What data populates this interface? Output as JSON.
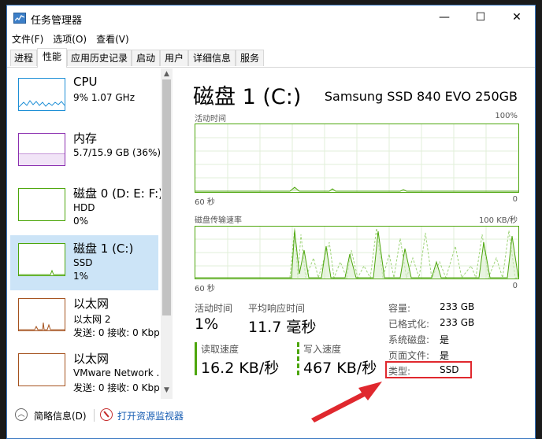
{
  "window": {
    "title": "任务管理器",
    "minimize": "—",
    "maximize": "☐",
    "close": "✕"
  },
  "menu": [
    "文件(F)",
    "选项(O)",
    "查看(V)"
  ],
  "tabs": [
    "进程",
    "性能",
    "应用历史记录",
    "启动",
    "用户",
    "详细信息",
    "服务"
  ],
  "active_tab": "性能",
  "sidebar": [
    {
      "name": "CPU",
      "sub1": "9% 1.07 GHz",
      "sub2": "",
      "color": "#1e8fd6"
    },
    {
      "name": "内存",
      "sub1": "5.7/15.9 GB (36%)",
      "sub2": "",
      "color": "#8b2fb0"
    },
    {
      "name": "磁盘 0 (D: E: F:)",
      "sub1": "HDD",
      "sub2": "0%",
      "color": "#4da60c"
    },
    {
      "name": "磁盘 1 (C:)",
      "sub1": "SSD",
      "sub2": "1%",
      "color": "#4da60c"
    },
    {
      "name": "以太网",
      "sub1": "以太网 2",
      "sub2": "发送: 0 接收: 0 Kbp",
      "color": "#a5521e"
    },
    {
      "name": "以太网",
      "sub1": "VMware Network .",
      "sub2": "发送: 0 接收: 0 Kbp",
      "color": "#a5521e"
    }
  ],
  "main": {
    "title": "磁盘 1 (C:)",
    "model": "Samsung SSD 840 EVO 250GB",
    "graph1": {
      "label": "活动时间",
      "max": "100%",
      "time": "60 秒",
      "min": "0"
    },
    "graph2": {
      "label": "磁盘传输速率",
      "max": "100 KB/秒",
      "time": "60 秒",
      "min": "0"
    }
  },
  "stats": {
    "active_label": "活动时间",
    "active_value": "1%",
    "response_label": "平均响应时间",
    "response_value": "11.7 毫秒",
    "read_label": "读取速度",
    "read_value": "16.2 KB/秒",
    "write_label": "写入速度",
    "write_value": "467 KB/秒"
  },
  "info": [
    {
      "label": "容量:",
      "value": "233 GB"
    },
    {
      "label": "已格式化:",
      "value": "233 GB"
    },
    {
      "label": "系统磁盘:",
      "value": "是"
    },
    {
      "label": "页面文件:",
      "value": "是"
    },
    {
      "label": "类型:",
      "value": "SSD"
    }
  ],
  "bottom": {
    "summary": "简略信息(D)",
    "monitor": "打开资源监视器"
  },
  "colors": {
    "disk": "#4da60c",
    "highlight": "#e0282e",
    "arrow": "#e0282e"
  }
}
